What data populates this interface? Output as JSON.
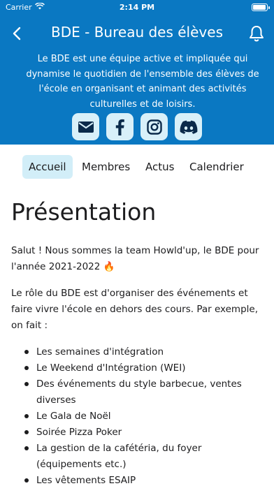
{
  "status_bar": {
    "carrier": "Carrier",
    "time": "2:14 PM"
  },
  "header": {
    "title": "BDE - Bureau des élèves",
    "description": "Le BDE est une équipe active et impliquée qui dynamise le quotidien de l'ensemble des élèves de l'école en organisant et animant des activités culturelles et de loisirs.",
    "background_color": "#0a78c2",
    "social_buttons": [
      {
        "icon": "email-icon"
      },
      {
        "icon": "facebook-icon"
      },
      {
        "icon": "instagram-icon"
      },
      {
        "icon": "discord-icon"
      }
    ]
  },
  "tabs": [
    {
      "label": "Accueil",
      "active": true
    },
    {
      "label": "Membres",
      "active": false
    },
    {
      "label": "Actus",
      "active": false
    },
    {
      "label": "Calendrier",
      "active": false
    }
  ],
  "content": {
    "title": "Présentation",
    "paragraphs": [
      "Salut ! Nous sommes la team Howld'up, le BDE pour l'année 2021-2022 🔥",
      "Le rôle du BDE est d'organiser des événements et faire vivre l'école en dehors des cours. Par exemple, on fait :"
    ],
    "list": [
      "Les semaines d'intégration",
      "Le Weekend d'Intégration (WEI)",
      "Des événements du style barbecue, ventes diverses",
      "Le Gala de Noël",
      "Soirée Pizza Poker",
      "La gestion de la cafétéria, du foyer (équipements etc.)",
      "Les vêtements ESAIP"
    ]
  }
}
